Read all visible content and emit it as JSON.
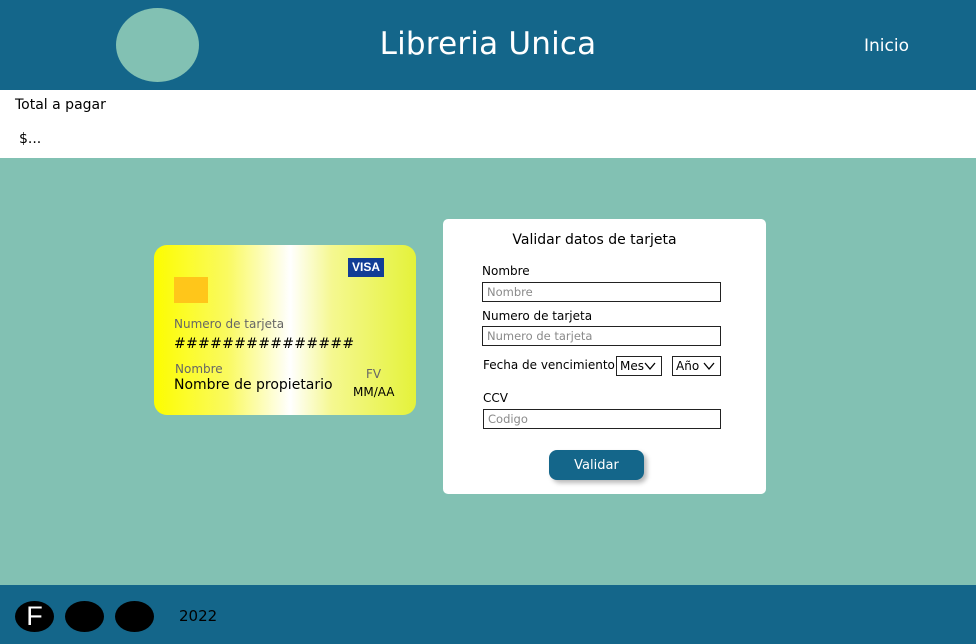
{
  "header": {
    "title": "Libreria Unica",
    "nav_home": "Inicio"
  },
  "total": {
    "label": "Total a pagar",
    "amount": "$..."
  },
  "card": {
    "brand": "VISA",
    "number_label": "Numero de tarjeta",
    "number": "###############",
    "name_label": "Nombre",
    "name": "Nombre de propietario",
    "expiry_label": "FV",
    "expiry": "MM/AA"
  },
  "form": {
    "title": "Validar datos de tarjeta",
    "name_label": "Nombre",
    "name_placeholder": "Nombre",
    "number_label": "Numero de tarjeta",
    "number_placeholder": "Numero de tarjeta",
    "expiry_label": "Fecha de vencimiento",
    "month_select": "Mes",
    "year_select": "Año",
    "ccv_label": "CCV",
    "ccv_placeholder": "Codigo",
    "submit_label": "Validar"
  },
  "footer": {
    "social_first_letter": "F",
    "year": "2022"
  },
  "colors": {
    "primary": "#14668a",
    "background": "#82c1b3",
    "chip": "#ffc61a",
    "visa": "#123d96"
  },
  "icons": [
    "logo-circle",
    "chip-icon",
    "chevron-down-icon",
    "facebook-icon",
    "social-icon"
  ]
}
